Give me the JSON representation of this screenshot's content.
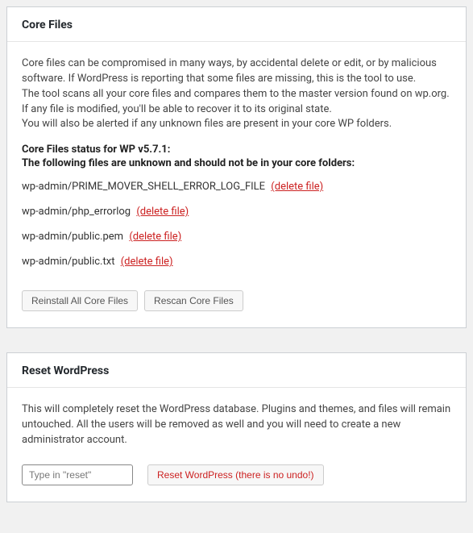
{
  "core_files": {
    "title": "Core Files",
    "intro_line1": "Core files can be compromised in many ways, by accidental delete or edit, or by malicious software. If WordPress is reporting that some files are missing, this is the tool to use.",
    "intro_line2": "The tool scans all your core files and compares them to the master version found on wp.org. If any file is modified, you'll be able to recover it to its original state.",
    "intro_line3": "You will also be alerted if any unknown files are present in your core WP folders.",
    "status_heading": "Core Files status for WP v5.7.1:",
    "status_subheading": "The following files are unknown and should not be in your core folders:",
    "files": [
      {
        "name": "wp-admin/PRIME_MOVER_SHELL_ERROR_LOG_FILE",
        "action": "(delete file)"
      },
      {
        "name": "wp-admin/php_errorlog",
        "action": "(delete file)"
      },
      {
        "name": "wp-admin/public.pem",
        "action": "(delete file)"
      },
      {
        "name": "wp-admin/public.txt",
        "action": "(delete file)"
      }
    ],
    "reinstall_button": "Reinstall All Core Files",
    "rescan_button": "Rescan Core Files"
  },
  "reset_wp": {
    "title": "Reset WordPress",
    "description": "This will completely reset the WordPress database. Plugins and themes, and files will remain untouched. All the users will be removed as well and you will need to create a new administrator account.",
    "input_placeholder": "Type in \"reset\"",
    "input_value": "",
    "button_label": "Reset WordPress (there is no undo!)"
  }
}
